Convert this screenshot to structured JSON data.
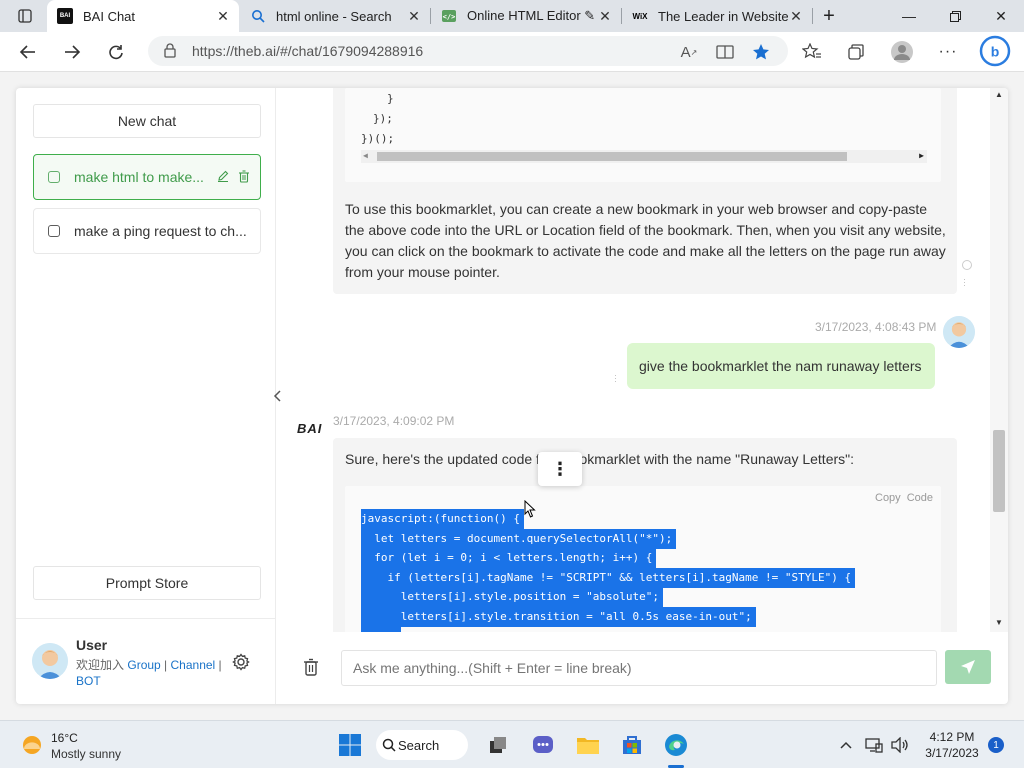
{
  "browser": {
    "tabs": [
      {
        "title": "BAI Chat",
        "favicon": "BAI"
      },
      {
        "title": "html online - Search"
      },
      {
        "title": "Online HTML Editor ✎ I"
      },
      {
        "title": "The Leader in Website C",
        "favicon": "WiX"
      }
    ],
    "url": "https://theb.ai/#/chat/1679094288916"
  },
  "sidebar": {
    "new_chat": "New chat",
    "conversations": [
      {
        "label": "make html to make..."
      },
      {
        "label": "make a ping request to ch..."
      }
    ],
    "prompt_store": "Prompt Store",
    "user": {
      "name": "User",
      "join_text": "欢迎加入",
      "link_group": "Group",
      "sep1": " | ",
      "link_channel": "Channel",
      "sep2": " |",
      "link_bot": "BOT"
    }
  },
  "chat": {
    "code_top_lines": [
      "}",
      "});",
      "})();"
    ],
    "bot_paragraph": "To use this bookmarklet, you can create a new bookmark in your web browser and copy-paste the above code into the URL or Location field of the bookmark. Then, when you visit any website, you can click on the bookmark to activate the code and make all the letters on the page run away from your mouse pointer.",
    "user_timestamp": "3/17/2023, 4:08:43 PM",
    "user_message": "give the bookmarklet the nam runaway letters",
    "bot_logo": "BAI",
    "bot_timestamp": "3/17/2023, 4:09:02 PM",
    "bot_reply_part1": "Sure, here's the updated code f",
    "bot_reply_part2": "bookmarklet with the name \"Runaway Letters\":",
    "copy_label": "Copy",
    "code_label": "Code",
    "code_lines": [
      "javascript:(function() {",
      "  let letters = document.querySelectorAll(\"*\");",
      "  for (let i = 0; i < letters.length; i++) {",
      "    if (letters[i].tagName != \"SCRIPT\" && letters[i].tagName != \"STYLE\") {",
      "      letters[i].style.position = \"absolute\";",
      "      letters[i].style.transition = \"all 0.5s ease-in-out\";"
    ],
    "input_placeholder": "Ask me anything...(Shift + Enter = line break)"
  },
  "taskbar": {
    "temperature": "16°C",
    "weather": "Mostly sunny",
    "search_label": "Search",
    "time": "4:12 PM",
    "date": "3/17/2023",
    "notification_count": "1"
  },
  "colors": {
    "accent_green": "#3fae4b",
    "user_bubble": "#dcf7cf",
    "selection": "#1a73e8",
    "send_button": "#a3d9b1"
  }
}
